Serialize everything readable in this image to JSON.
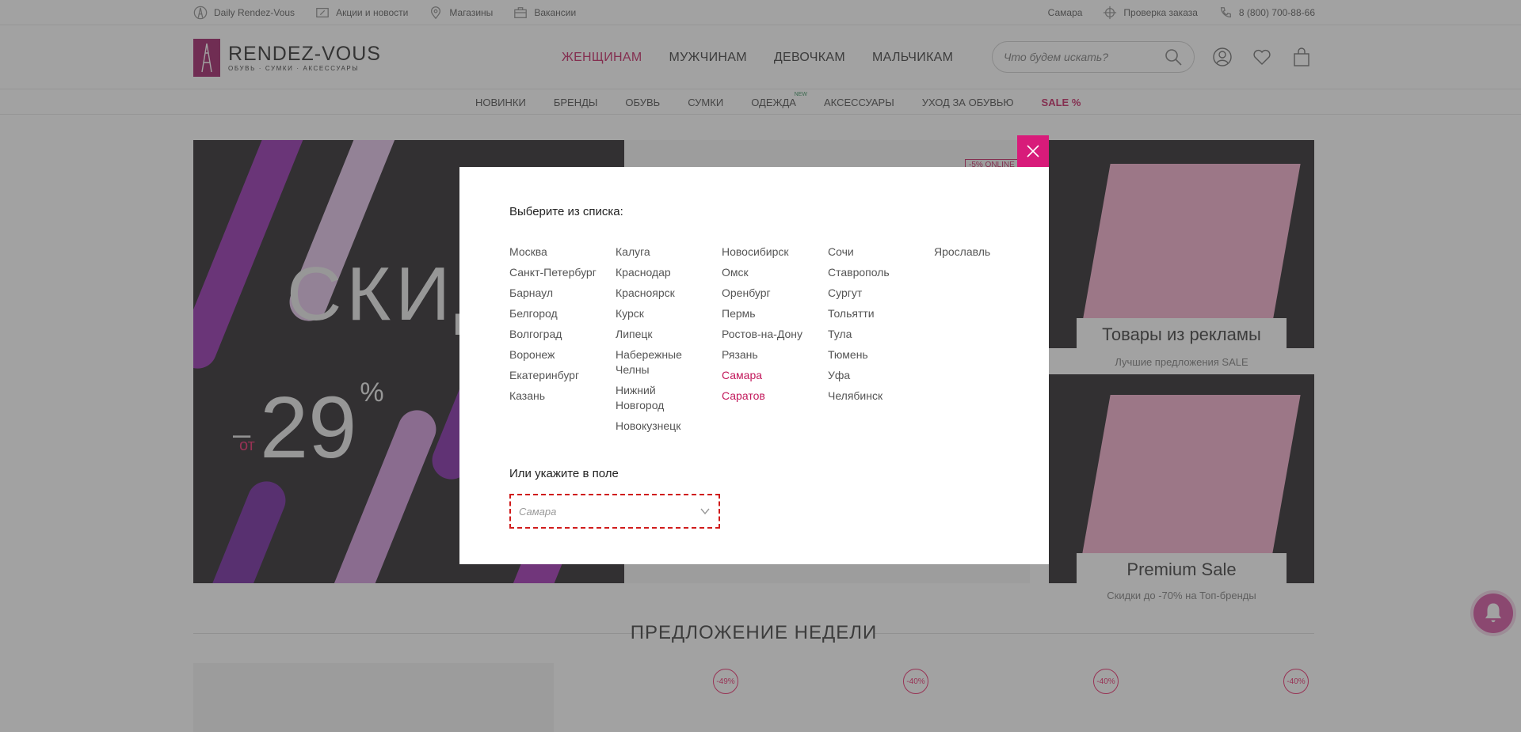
{
  "topbar": {
    "left": [
      {
        "icon": "eiffel-tower-icon",
        "label": "Daily Rendez-Vous"
      },
      {
        "icon": "percent-tag-icon",
        "label": "Акции и новости"
      },
      {
        "icon": "map-pin-icon",
        "label": "Магазины"
      },
      {
        "icon": "briefcase-icon",
        "label": "Вакансии"
      }
    ],
    "city": "Самара",
    "order_check": "Проверка заказа",
    "phone": "8 (800) 700-88-66"
  },
  "header": {
    "logo_brand": "RENDEZ-VOUS",
    "logo_tagline": "ОБУВЬ · СУМКИ · АКСЕССУАРЫ",
    "main_nav": [
      "ЖЕНЩИНАМ",
      "МУЖЧИНАМ",
      "ДЕВОЧКАМ",
      "МАЛЬЧИКАМ"
    ],
    "active_nav": "ЖЕНЩИНАМ",
    "search_placeholder": "Что будем искать?"
  },
  "subnav": {
    "items": [
      "НОВИНКИ",
      "БРЕНДЫ",
      "ОБУВЬ",
      "СУМКИ",
      "ОДЕЖДА",
      "АКСЕССУАРЫ",
      "УХОД ЗА ОБУВЬЮ",
      "SALE %"
    ],
    "new_badge": "NEW"
  },
  "banner": {
    "headline": "СКИД",
    "prefix": "–",
    "from": "от",
    "discount": "29",
    "percent": "%",
    "online_badge": "-5% ONLINE"
  },
  "side_banners": [
    {
      "title": "Товары из рекламы",
      "caption": "Лучшие предложения SALE"
    },
    {
      "title": "Premium Sale",
      "caption": "Скидки до -70% на Топ-бренды"
    }
  ],
  "week_title": "ПРЕДЛОЖЕНИЕ НЕДЕЛИ",
  "product_badges": [
    "-49%",
    "-40%",
    "-40%",
    "-40%"
  ],
  "modal": {
    "title": "Выберите из списка:",
    "columns": [
      [
        "Москва",
        "Санкт-Петербург",
        "Барнаул",
        "Белгород",
        "Волгоград",
        "Воронеж",
        "Екатеринбург",
        "Казань"
      ],
      [
        "Калуга",
        "Краснодар",
        "Красноярск",
        "Курск",
        "Липецк",
        "Набережные Челны",
        "Нижний Новгород",
        "Новокузнецк"
      ],
      [
        "Новосибирск",
        "Омск",
        "Оренбург",
        "Пермь",
        "Ростов-на-Дону",
        "Рязань",
        "Самара",
        "Саратов"
      ],
      [
        "Сочи",
        "Ставрополь",
        "Сургут",
        "Тольятти",
        "Тула",
        "Тюмень",
        "Уфа",
        "Челябинск"
      ],
      [
        "Ярославль"
      ]
    ],
    "selected_cities": [
      "Самара",
      "Саратов"
    ],
    "field_title": "Или укажите в поле",
    "field_value": "Самара"
  },
  "colors": {
    "accent": "#c2185b",
    "close_button": "#d81b7a",
    "field_border": "#d01c1c"
  }
}
